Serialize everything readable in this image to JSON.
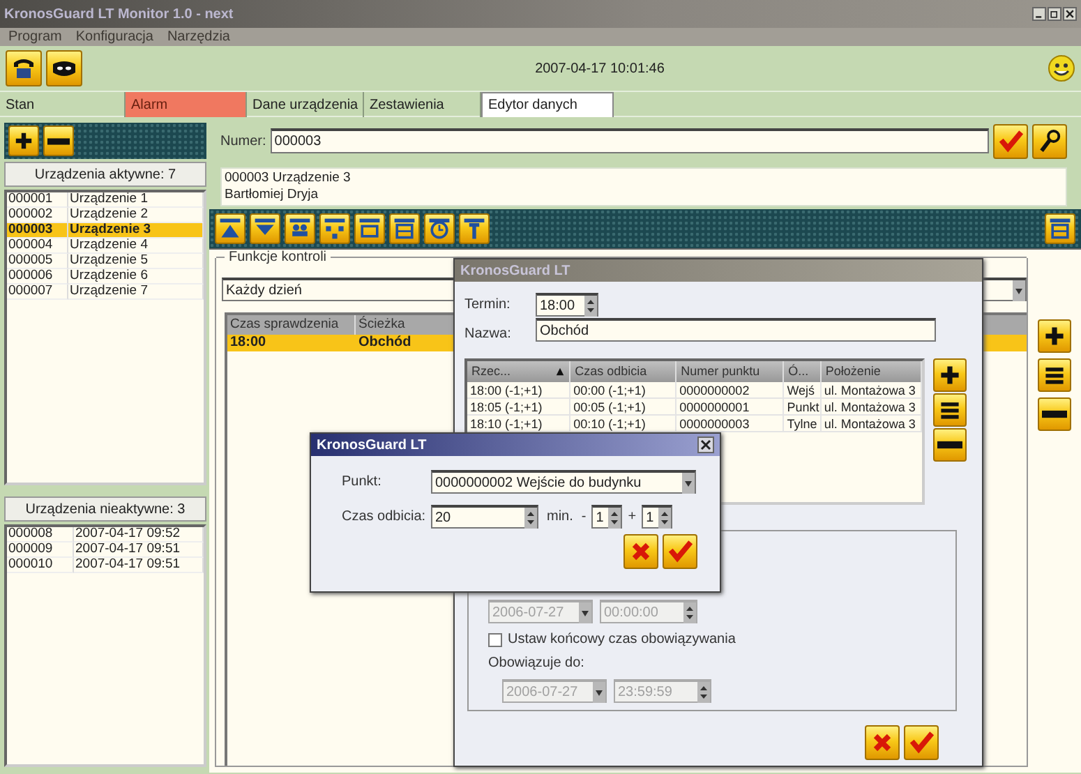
{
  "window": {
    "title": "KronosGuard LT Monitor 1.0 - next"
  },
  "menu": [
    "Program",
    "Konfiguracja",
    "Narzędzia"
  ],
  "datetime": "2007-04-17 10:01:46",
  "tabs": [
    {
      "label": "Stan",
      "selected": false,
      "alert": false
    },
    {
      "label": "Alarm",
      "selected": false,
      "alert": true
    },
    {
      "label": "Dane urządzenia",
      "selected": false,
      "alert": false
    },
    {
      "label": "Zestawienia",
      "selected": false,
      "alert": false
    },
    {
      "label": "Edytor danych",
      "selected": true,
      "alert": false
    }
  ],
  "active_devices": {
    "header": "Urządzenia aktywne: 7",
    "rows": [
      {
        "id": "000001",
        "name": "Urządzenie 1",
        "selected": false
      },
      {
        "id": "000002",
        "name": "Urządzenie 2",
        "selected": false
      },
      {
        "id": "000003",
        "name": "Urządzenie 3",
        "selected": true
      },
      {
        "id": "000004",
        "name": "Urządzenie 4",
        "selected": false
      },
      {
        "id": "000005",
        "name": "Urządzenie 5",
        "selected": false
      },
      {
        "id": "000006",
        "name": "Urządzenie 6",
        "selected": false
      },
      {
        "id": "000007",
        "name": "Urządzenie 7",
        "selected": false
      }
    ]
  },
  "inactive_devices": {
    "header": "Urządzenia nieaktywne: 3",
    "rows": [
      {
        "id": "000008",
        "time": "2007-04-17 09:52"
      },
      {
        "id": "000009",
        "time": "2007-04-17 09:51"
      },
      {
        "id": "000010",
        "time": "2007-04-17 09:51"
      }
    ]
  },
  "numer": {
    "label": "Numer:",
    "value": "000003"
  },
  "info_lines": [
    "000003 Urządzenie 3",
    "Bartłomiej Dryja"
  ],
  "control_functions": {
    "title": "Funkcje kontroli",
    "schedule": "Każdy dzień",
    "columns": [
      "Czas sprawdzenia",
      "Ścieżka"
    ],
    "rows": [
      {
        "cells": [
          "18:00",
          "Obchód"
        ],
        "selected": true
      }
    ]
  },
  "path_dialog": {
    "title": "KronosGuard LT",
    "termin_label": "Termin:",
    "termin": "18:00",
    "name_label": "Nazwa:",
    "name": "Obchód",
    "columns": [
      "Rzec...",
      "Czas odbicia",
      "Numer punktu",
      "Ó...",
      "Położenie"
    ],
    "rows": [
      {
        "cells": [
          "18:00 (-1;+1)",
          "00:00 (-1;+1)",
          "0000000002",
          "Wejś",
          "ul. Montażowa 3"
        ]
      },
      {
        "cells": [
          "18:05 (-1;+1)",
          "00:05 (-1;+1)",
          "0000000001",
          "Punkt",
          "ul. Montażowa 3"
        ]
      },
      {
        "cells": [
          "18:10 (-1;+1)",
          "00:10 (-1;+1)",
          "0000000003",
          "Tylne",
          "ul. Montażowa 3"
        ]
      }
    ],
    "dates_disabled": true,
    "start_date": "2006-07-27",
    "start_time": "00:00:00",
    "end_checkbox": {
      "label": "Ustaw końcowy czas obowiązywania",
      "checked": false
    },
    "valid_to_label": "Obowiązuje do:",
    "end_date": "2006-07-27",
    "end_time": "23:59:59"
  },
  "point_dialog": {
    "title": "KronosGuard LT",
    "point_label": "Punkt:",
    "point": "0000000002 Wejście do budynku",
    "time_label": "Czas odbicia:",
    "time": "20",
    "unit": "min.",
    "minus_sign": "-",
    "minus": "1",
    "plus_sign": "+",
    "plus": "1"
  }
}
